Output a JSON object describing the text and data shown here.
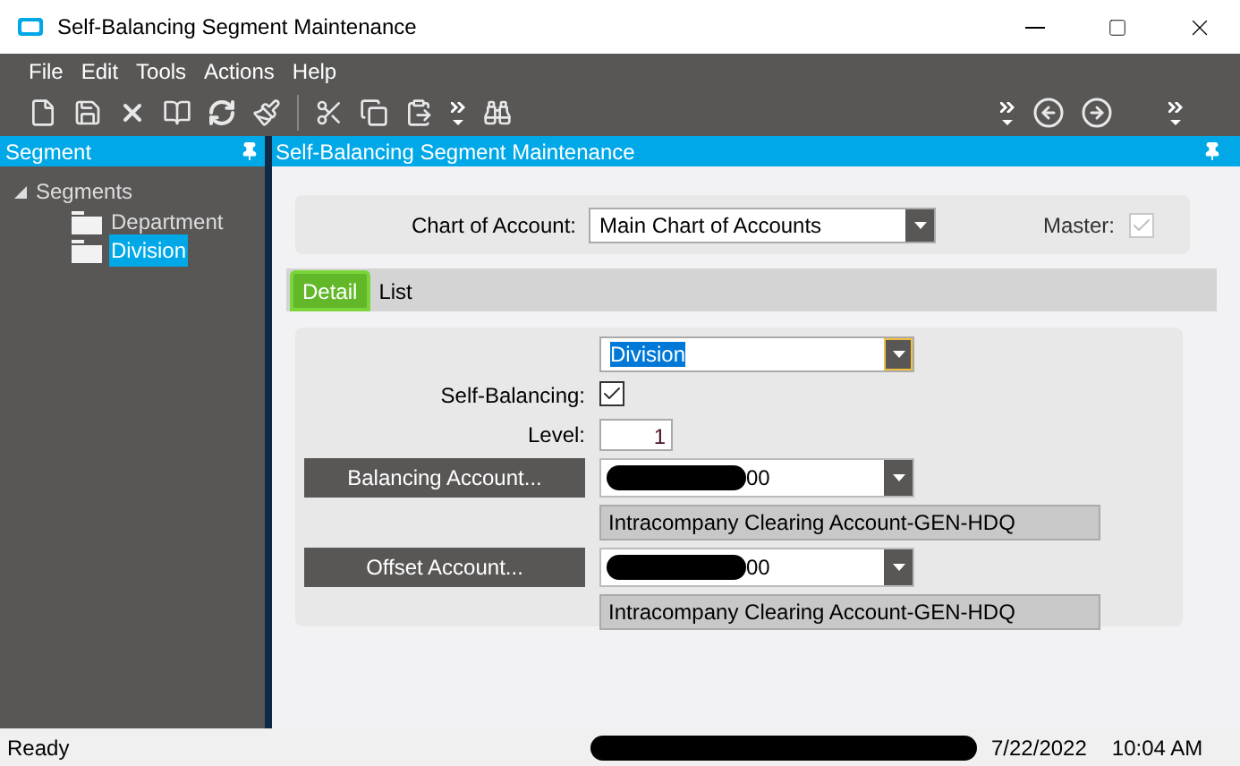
{
  "window": {
    "title": "Self-Balancing Segment Maintenance"
  },
  "menu": [
    "File",
    "Edit",
    "Tools",
    "Actions",
    "Help"
  ],
  "sidebar": {
    "title": "Segment",
    "tree": [
      {
        "label": "Segments",
        "expanded": true,
        "selected": false,
        "children": [
          {
            "label": "Department",
            "selected": false
          },
          {
            "label": "Division",
            "selected": true
          }
        ]
      }
    ]
  },
  "panel": {
    "title": "Self-Balancing Segment Maintenance"
  },
  "chart_of_account": {
    "label": "Chart of Account:",
    "value": "Main Chart of Accounts"
  },
  "master": {
    "label": "Master:",
    "checked": true,
    "disabled": true
  },
  "tabs": [
    {
      "label": "Detail",
      "selected": true
    },
    {
      "label": "List",
      "selected": false
    }
  ],
  "segment": {
    "value": "Division"
  },
  "self_balancing": {
    "label": "Self-Balancing:",
    "checked": true
  },
  "level_field": {
    "label": "Level:",
    "value": "1"
  },
  "balancing_account": {
    "button": "Balancing Account...",
    "value": "00",
    "description": "Intracompany Clearing Account-GEN-HDQ"
  },
  "offset_account": {
    "button": "Offset Account...",
    "value": "00",
    "description": "Intracompany Clearing Account-GEN-HDQ"
  },
  "status_bar": {
    "status": "Ready",
    "date": "7/22/2022",
    "time": "10:04 AM"
  }
}
